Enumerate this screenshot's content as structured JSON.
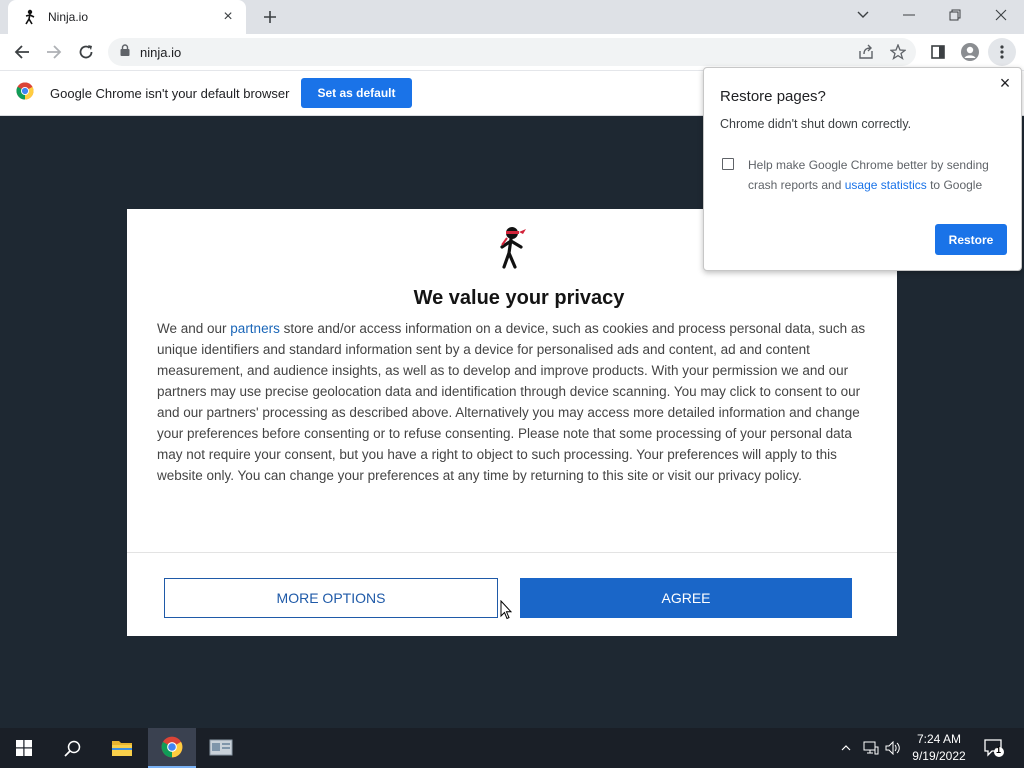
{
  "tab": {
    "title": "Ninja.io",
    "close_icon": "close-icon"
  },
  "toolbar": {
    "url": "ninja.io"
  },
  "infobar": {
    "message": "Google Chrome isn't your default browser",
    "button": "Set as default"
  },
  "consent": {
    "title": "We value your privacy",
    "body_pre": "We and our ",
    "body_link": "partners",
    "body_post": " store and/or access information on a device, such as cookies and process personal data, such as unique identifiers and standard information sent by a device for personalised ads and content, ad and content measurement, and audience insights, as well as to develop and improve products. With your permission we and our partners may use precise geolocation data and identification through device scanning. You may click to consent to our and our partners' processing as described above. Alternatively you may access more detailed information and change your preferences before consenting or to refuse consenting. Please note that some processing of your personal data may not require your consent, but you have a right to object to such processing. Your preferences will apply to this website only. You can change your preferences at any time by returning to this site or visit our privacy policy.",
    "more_options": "MORE OPTIONS",
    "agree": "AGREE"
  },
  "restore": {
    "title": "Restore pages?",
    "message": "Chrome didn't shut down correctly.",
    "checkbox_pre": "Help make Google Chrome better by sending crash reports and ",
    "checkbox_link": "usage statistics",
    "checkbox_post": " to Google",
    "checkbox_checked": false,
    "button": "Restore"
  },
  "taskbar": {
    "time": "7:24 AM",
    "date": "9/19/2022",
    "notification_count": "1"
  },
  "colors": {
    "accent": "#1a73e8",
    "consent_agree": "#1a66c8",
    "page_bg": "#1e2832",
    "taskbar_bg": "#1a1f27"
  }
}
